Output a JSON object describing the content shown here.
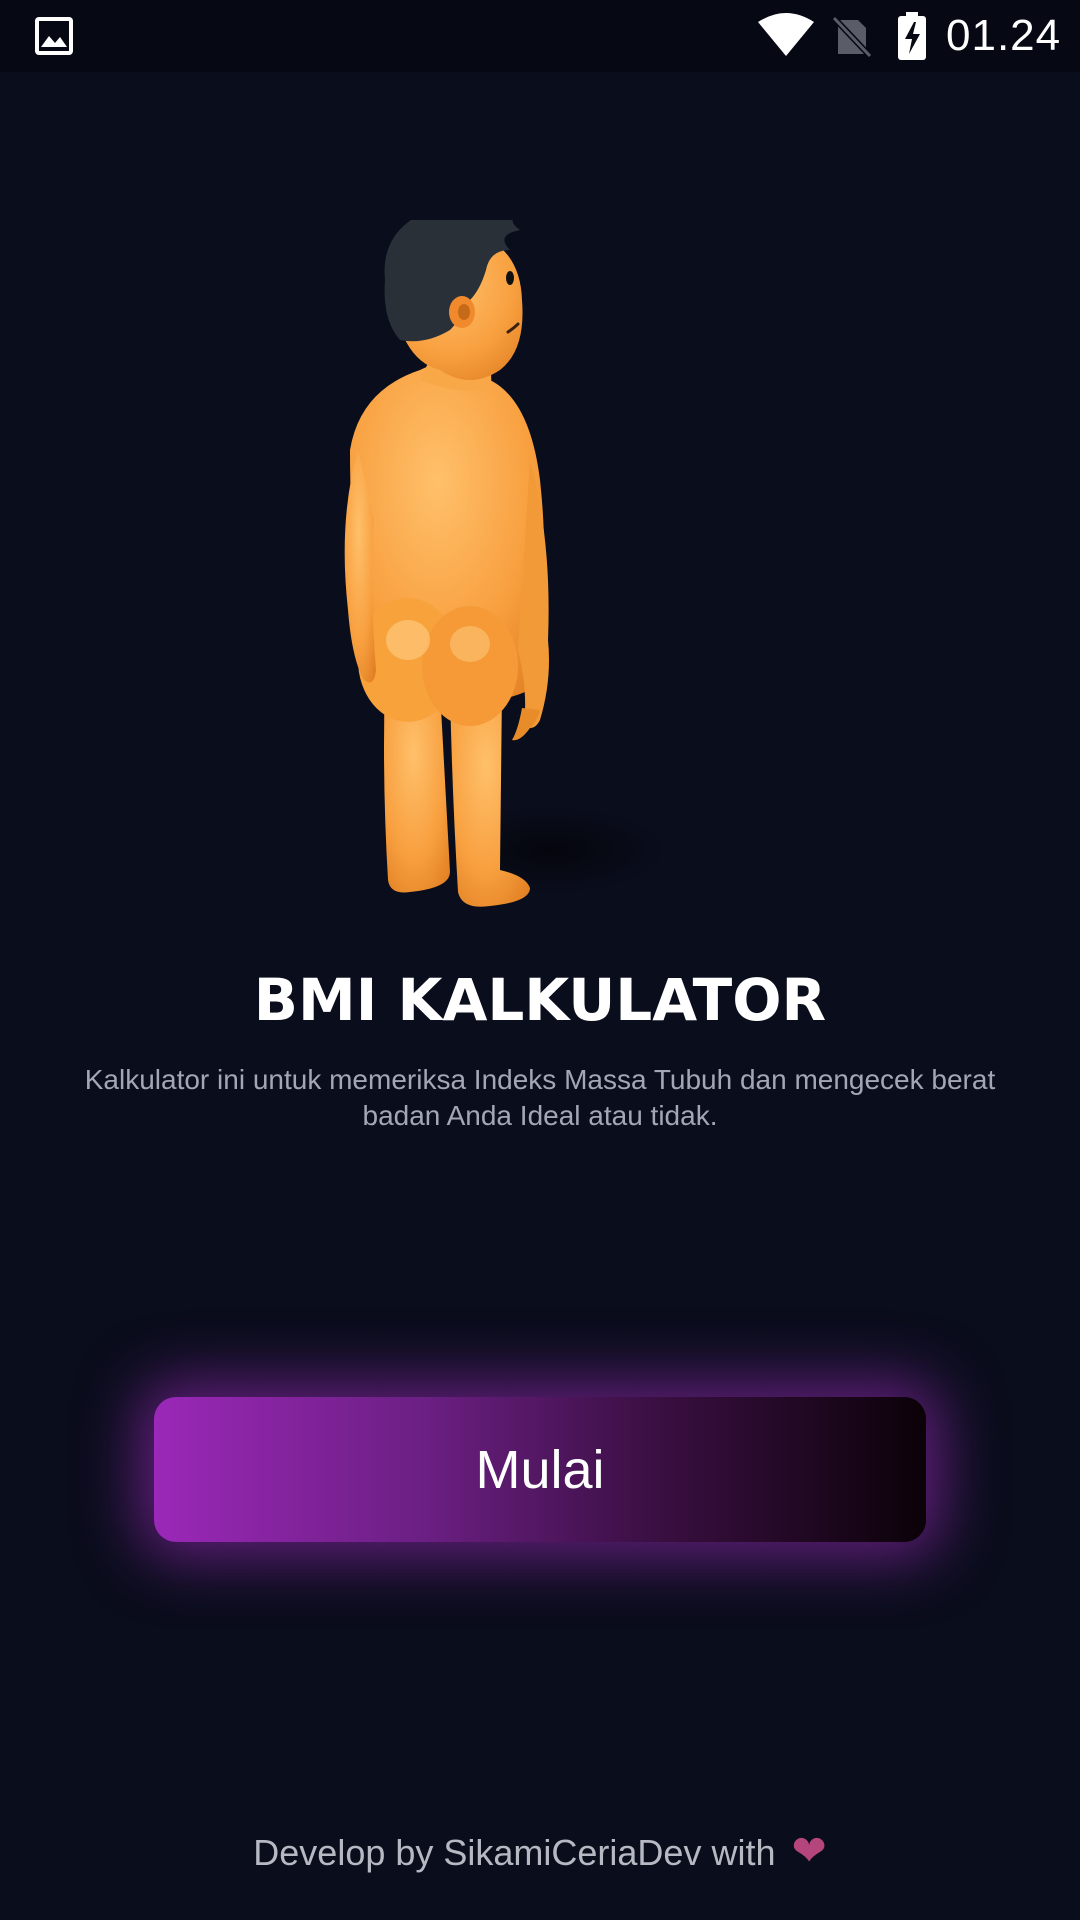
{
  "status_bar": {
    "time": "01.24",
    "icons": [
      "gallery-icon",
      "wifi-icon",
      "no-sim-icon",
      "battery-charging-icon"
    ]
  },
  "main": {
    "illustration": "person-standing-illustration",
    "title": "BMI KALKULATOR",
    "description": "Kalkulator ini untuk memeriksa Indeks Massa Tubuh dan mengecek berat badan Anda Ideal atau tidak.",
    "start_button_label": "Mulai"
  },
  "footer": {
    "text": "Develop by SikamiCeriaDev with",
    "heart": "❤"
  },
  "colors": {
    "background": "#0a0d1c",
    "button_gradient_start": "#9b28b8",
    "button_gradient_end": "#0b0208",
    "heart": "#b4457d"
  }
}
